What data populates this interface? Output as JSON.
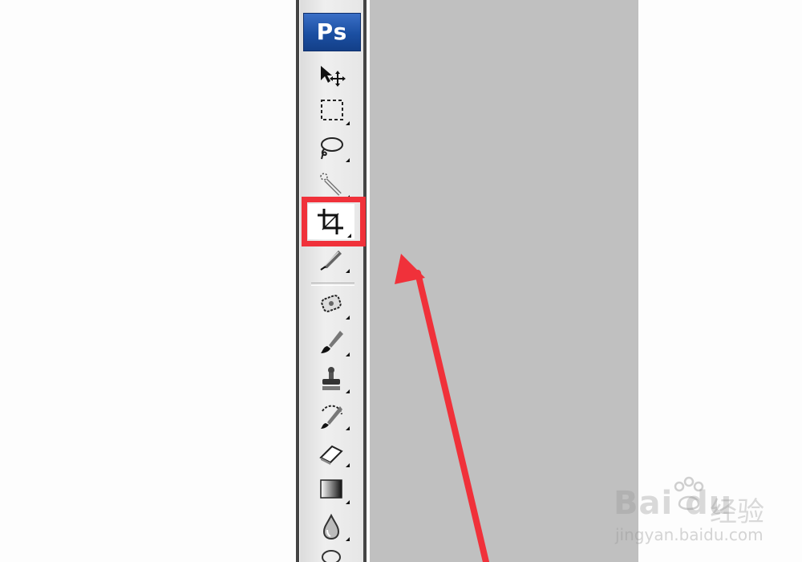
{
  "app": {
    "logo_text": "Ps"
  },
  "toolbar": {
    "tools": [
      {
        "name": "move-tool",
        "icon": "move-icon",
        "flyout": false,
        "selected": false
      },
      {
        "name": "marquee-tool",
        "icon": "rectangular-marquee-icon",
        "flyout": true,
        "selected": false
      },
      {
        "name": "lasso-tool",
        "icon": "lasso-icon",
        "flyout": true,
        "selected": false
      },
      {
        "name": "quick-selection-tool",
        "icon": "quick-selection-icon",
        "flyout": true,
        "selected": false
      },
      {
        "name": "crop-tool",
        "icon": "crop-icon",
        "flyout": true,
        "selected": true
      },
      {
        "name": "slice-tool",
        "icon": "slice-icon",
        "flyout": true,
        "selected": false
      },
      {
        "name": "healing-brush-tool",
        "icon": "healing-brush-icon",
        "flyout": true,
        "selected": false
      },
      {
        "name": "brush-tool",
        "icon": "brush-icon",
        "flyout": true,
        "selected": false
      },
      {
        "name": "clone-stamp-tool",
        "icon": "clone-stamp-icon",
        "flyout": true,
        "selected": false
      },
      {
        "name": "history-brush-tool",
        "icon": "history-brush-icon",
        "flyout": true,
        "selected": false
      },
      {
        "name": "eraser-tool",
        "icon": "eraser-icon",
        "flyout": true,
        "selected": false
      },
      {
        "name": "gradient-tool",
        "icon": "gradient-icon",
        "flyout": true,
        "selected": false
      },
      {
        "name": "blur-tool",
        "icon": "blur-drop-icon",
        "flyout": true,
        "selected": false
      },
      {
        "name": "dodge-tool",
        "icon": "dodge-icon",
        "flyout": true,
        "selected": false
      }
    ]
  },
  "annotation": {
    "highlight_color": "#f0313a",
    "arrow_color": "#f0313a"
  },
  "colors": {
    "canvas_background": "#c0c0c0",
    "logo_blue": "#1b4fa2"
  },
  "watermark": {
    "brand": "Bai du",
    "brand_cn": "经验",
    "url": "jingyan.baidu.com"
  }
}
